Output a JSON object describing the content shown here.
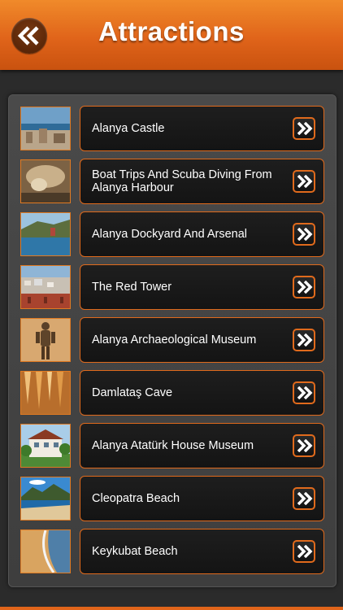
{
  "header": {
    "title": "Attractions",
    "back_icon": "double-chevron-left-icon",
    "accent": "#e06a1c"
  },
  "items": [
    {
      "label": "Alanya Castle",
      "thumb": "castle-photo"
    },
    {
      "label": "Boat Trips And Scuba Diving From Alanya Harbour",
      "thumb": "cave-photo"
    },
    {
      "label": "Alanya Dockyard And Arsenal",
      "thumb": "coast-photo"
    },
    {
      "label": "The Red Tower",
      "thumb": "tower-photo"
    },
    {
      "label": "Alanya Archaeological Museum",
      "thumb": "statue-photo"
    },
    {
      "label": "Damlataş Cave",
      "thumb": "stalactite-photo"
    },
    {
      "label": "Alanya Atatürk House Museum",
      "thumb": "house-photo"
    },
    {
      "label": "Cleopatra Beach",
      "thumb": "beach-photo"
    },
    {
      "label": "Keykubat Beach",
      "thumb": "shore-photo"
    }
  ],
  "row_action_icon": "double-chevron-right-icon"
}
